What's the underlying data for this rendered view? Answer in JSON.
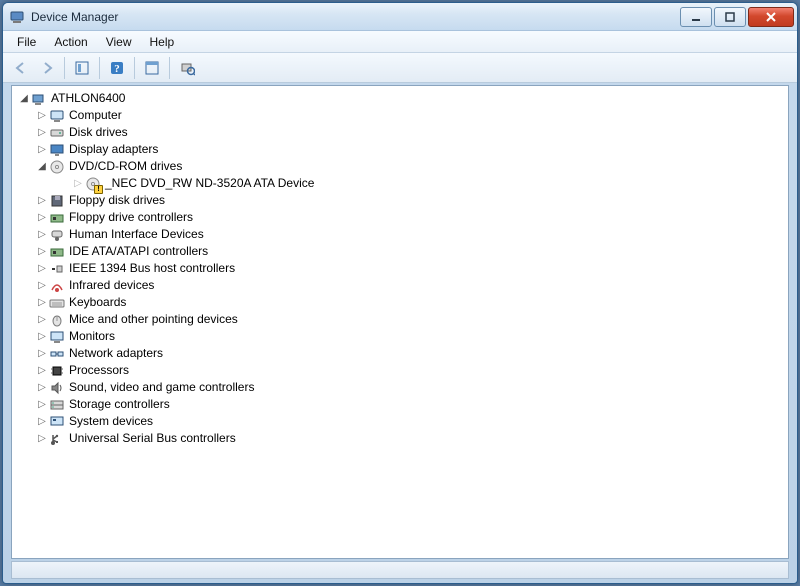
{
  "window": {
    "title": "Device Manager"
  },
  "menu": {
    "file": "File",
    "action": "Action",
    "view": "View",
    "help": "Help"
  },
  "tree": {
    "root": "ATHLON6400",
    "nodes": [
      {
        "label": "Computer",
        "icon": "computer"
      },
      {
        "label": "Disk drives",
        "icon": "disk"
      },
      {
        "label": "Display adapters",
        "icon": "display"
      },
      {
        "label": "DVD/CD-ROM drives",
        "icon": "dvd",
        "expanded": true,
        "children": [
          {
            "label": "_NEC DVD_RW ND-3520A ATA Device",
            "icon": "dvd",
            "warn": true
          }
        ]
      },
      {
        "label": "Floppy disk drives",
        "icon": "floppy"
      },
      {
        "label": "Floppy drive controllers",
        "icon": "controller"
      },
      {
        "label": "Human Interface Devices",
        "icon": "hid"
      },
      {
        "label": "IDE ATA/ATAPI controllers",
        "icon": "controller"
      },
      {
        "label": "IEEE 1394 Bus host controllers",
        "icon": "ieee1394"
      },
      {
        "label": "Infrared devices",
        "icon": "infrared"
      },
      {
        "label": "Keyboards",
        "icon": "keyboard"
      },
      {
        "label": "Mice and other pointing devices",
        "icon": "mouse"
      },
      {
        "label": "Monitors",
        "icon": "monitor"
      },
      {
        "label": "Network adapters",
        "icon": "network"
      },
      {
        "label": "Processors",
        "icon": "cpu"
      },
      {
        "label": "Sound, video and game controllers",
        "icon": "sound"
      },
      {
        "label": "Storage controllers",
        "icon": "storage"
      },
      {
        "label": "System devices",
        "icon": "system"
      },
      {
        "label": "Universal Serial Bus controllers",
        "icon": "usb"
      }
    ]
  }
}
